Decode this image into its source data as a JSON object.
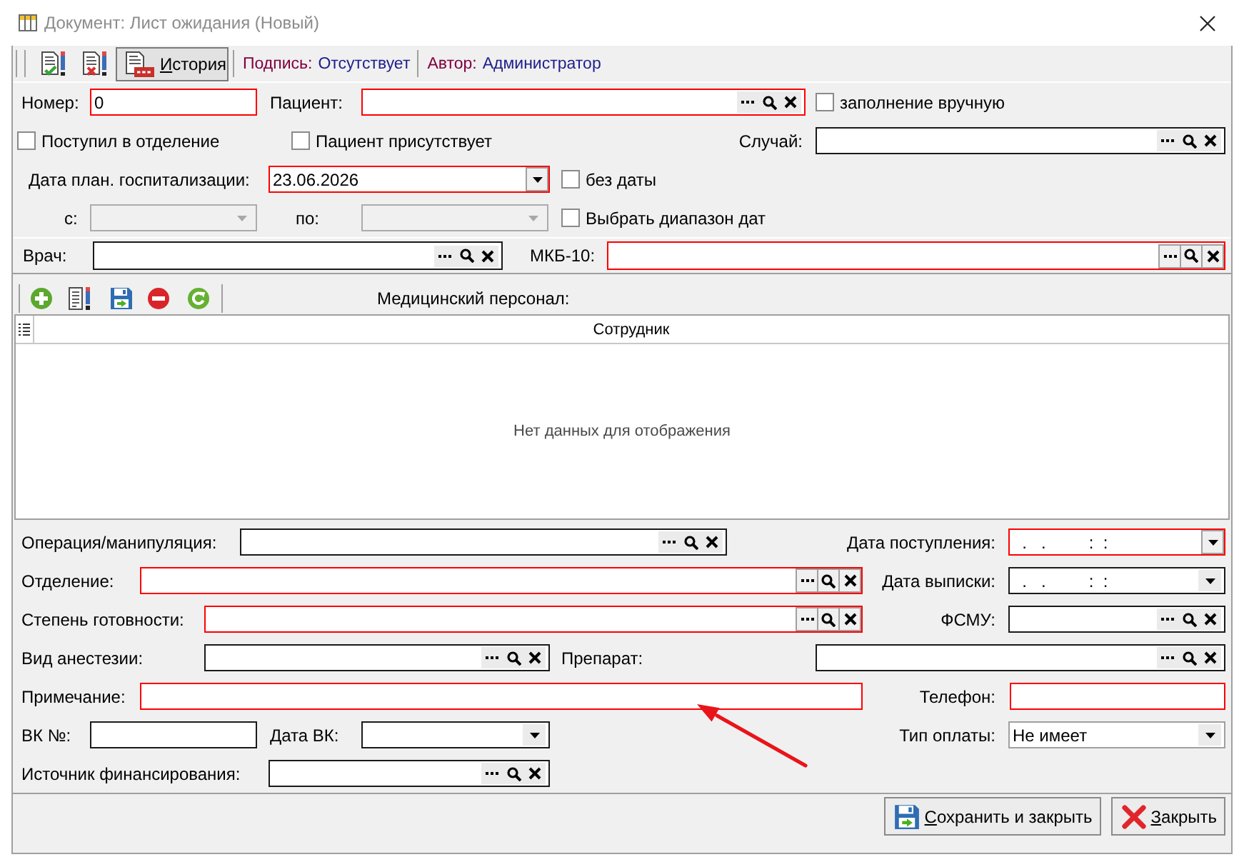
{
  "window": {
    "title": "Документ: Лист ожидания (Новый)"
  },
  "toolbar": {
    "history_button": {
      "label": "История",
      "pressed": true,
      "mnemonic": true
    },
    "signature": {
      "label": "Подпись:",
      "value": "Отсутствует"
    },
    "author": {
      "label": "Автор:",
      "value": "Администратор"
    }
  },
  "header_form": {
    "number": {
      "kind": "text",
      "label": "Номер:",
      "value": "0",
      "required": true
    },
    "patient": {
      "kind": "lookup",
      "label": "Пациент:",
      "required": true,
      "buttons_framed": false
    },
    "manual_fill": {
      "kind": "checkbox",
      "label": "заполнение вручную",
      "checked": false
    },
    "admitted": {
      "kind": "checkbox",
      "label": "Поступил в отделение",
      "checked": false
    },
    "patient_present": {
      "kind": "checkbox",
      "label": "Пациент присутствует",
      "checked": false
    },
    "case": {
      "kind": "lookup",
      "label": "Случай:",
      "required": false,
      "buttons_framed": false
    },
    "planned_date": {
      "kind": "date",
      "label": "Дата план. госпитализации:",
      "value": "23.06.2026",
      "required": true,
      "buttons_framed": true
    },
    "no_date": {
      "kind": "checkbox",
      "label": "без даты",
      "checked": false
    },
    "date_from": {
      "kind": "combo",
      "label": "с:",
      "disabled": true
    },
    "date_to": {
      "kind": "combo",
      "label": "по:",
      "disabled": true
    },
    "date_range": {
      "kind": "checkbox",
      "label": "Выбрать диапазон дат",
      "checked": false
    },
    "doctor": {
      "kind": "lookup",
      "label": "Врач:",
      "required": false,
      "buttons_framed": false
    },
    "icd10": {
      "kind": "lookup",
      "label": "МКБ-10:",
      "required": true,
      "buttons_framed": true
    }
  },
  "staff": {
    "title": "Медицинский персонал:",
    "columns": [
      "Сотрудник"
    ],
    "empty_text": "Нет данных для отображения"
  },
  "details_form": {
    "operation": {
      "kind": "lookup",
      "label": "Операция/манипуляция:",
      "required": false,
      "buttons_framed": false
    },
    "admission_date": {
      "kind": "date",
      "label": "Дата поступления:",
      "value": "  .   .         :  :",
      "required": true,
      "buttons_framed": true
    },
    "department": {
      "kind": "lookup",
      "label": "Отделение:",
      "required": true,
      "buttons_framed": true
    },
    "discharge_date": {
      "kind": "date",
      "label": "Дата выписки:",
      "value": "  .   .         :  :",
      "required": false,
      "buttons_framed": false
    },
    "readiness": {
      "kind": "lookup",
      "label": "Степень готовности:",
      "required": true,
      "buttons_framed": true
    },
    "fsmu": {
      "kind": "lookup",
      "label": "ФСМУ:",
      "required": false,
      "buttons_framed": false
    },
    "anesthesia": {
      "kind": "lookup",
      "label": "Вид анестезии:",
      "required": false,
      "buttons_framed": false
    },
    "drug": {
      "kind": "lookup",
      "label": "Препарат:",
      "required": false,
      "buttons_framed": false
    },
    "note": {
      "kind": "text",
      "label": "Примечание:",
      "required": true
    },
    "phone": {
      "kind": "text",
      "label": "Телефон:",
      "required": true
    },
    "vk_number": {
      "kind": "text",
      "label": "ВК №:",
      "required": false
    },
    "vk_date": {
      "kind": "combo",
      "label": "Дата ВК:",
      "required": false,
      "buttons_framed": false
    },
    "payment_type": {
      "kind": "select",
      "label": "Тип оплаты:",
      "value": "Не имеет",
      "buttons_framed": false
    },
    "funding_source": {
      "kind": "lookup",
      "label": "Источник финансирования:",
      "required": false,
      "buttons_framed": false
    }
  },
  "footer": {
    "buttons": [
      {
        "kind": "save",
        "label": "Сохранить и закрыть",
        "mnemonic": true
      },
      {
        "kind": "close",
        "label": "Закрыть",
        "mnemonic": true
      }
    ]
  }
}
